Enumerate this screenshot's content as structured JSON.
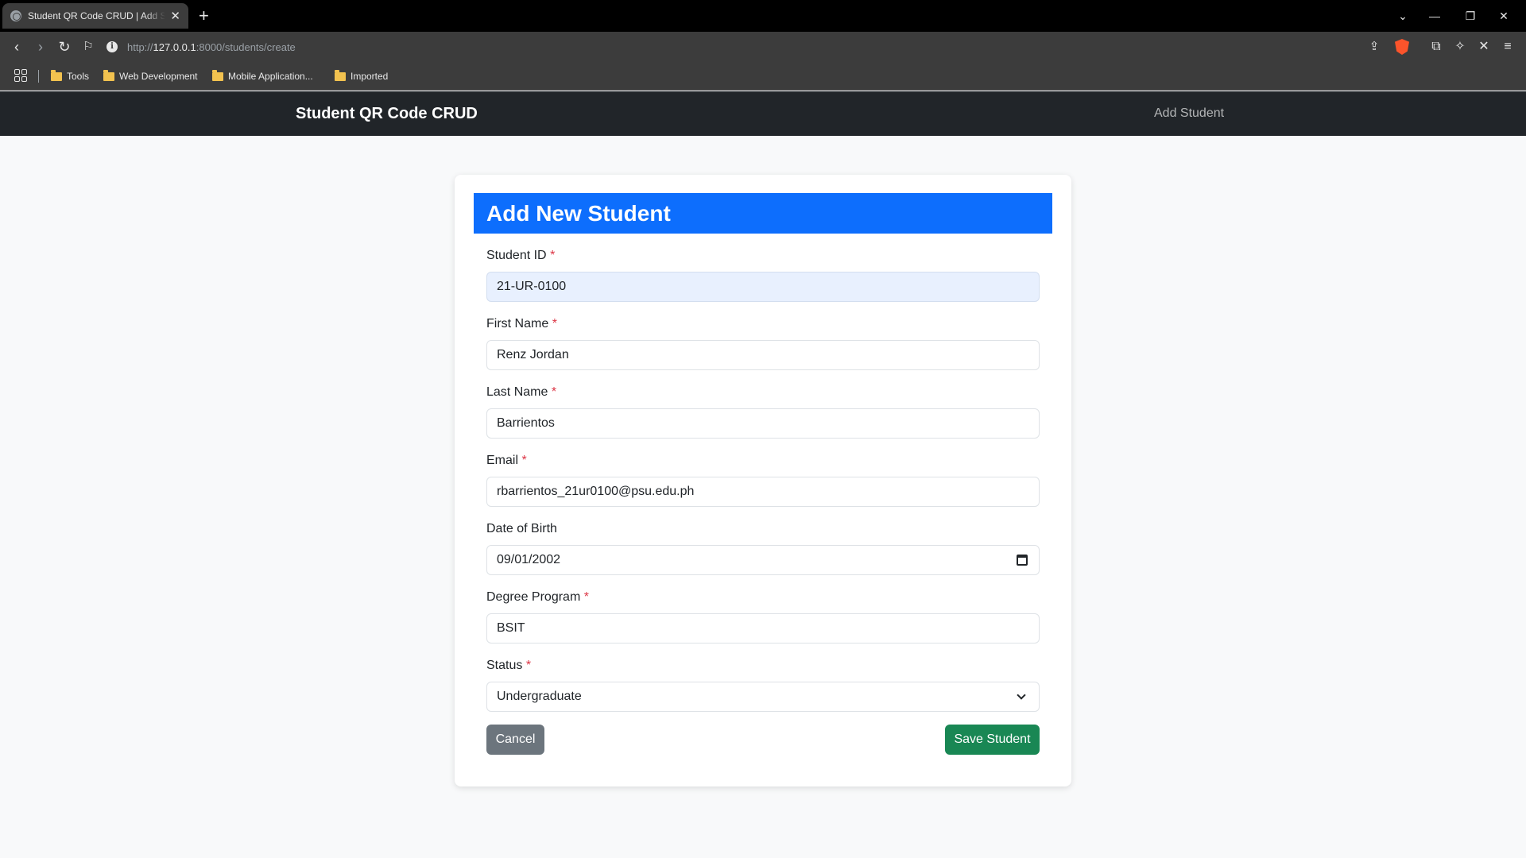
{
  "browser": {
    "tab_title": "Student QR Code CRUD | Add Student",
    "url_scheme": "http://",
    "url_host": "127.0.0.1",
    "url_rest": ":8000/students/create",
    "bookmarks": [
      "Tools",
      "Web Development",
      "Mobile Application...",
      "Imported"
    ]
  },
  "navbar": {
    "brand": "Student QR Code CRUD",
    "link": "Add Student"
  },
  "form": {
    "title": "Add New Student",
    "required_mark": "*",
    "fields": [
      {
        "label": "Student ID",
        "value": "21-UR-0100",
        "required": true
      },
      {
        "label": "First Name",
        "value": "Renz Jordan",
        "required": true
      },
      {
        "label": "Last Name",
        "value": "Barrientos",
        "required": true
      },
      {
        "label": "Email",
        "value": "rbarrientos_21ur0100@psu.edu.ph",
        "required": true
      },
      {
        "label": "Date of Birth",
        "value": "09/01/2002",
        "required": false
      },
      {
        "label": "Degree Program",
        "value": "BSIT",
        "required": true
      },
      {
        "label": "Status",
        "value": "Undergraduate",
        "required": true
      }
    ],
    "cancel_label": "Cancel",
    "save_label": "Save Student"
  },
  "colors": {
    "navbar_bg": "#212529",
    "header_bg": "#0d6efd",
    "save_bg": "#198754",
    "cancel_bg": "#6c757d",
    "required": "#dc3545"
  }
}
